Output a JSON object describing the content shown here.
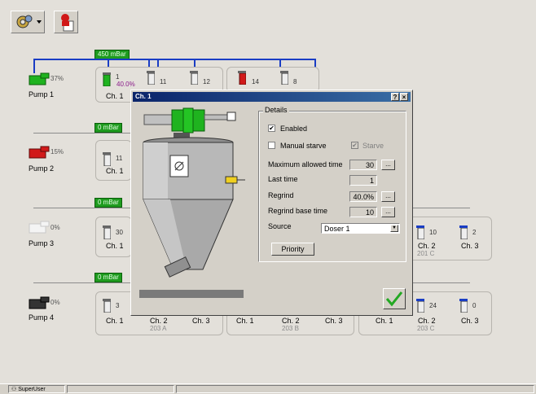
{
  "toolbar": {
    "settings_icon": "gear-cog-icon",
    "alarm_icon": "alarm-person-icon"
  },
  "vacuum": {
    "row1": "450 mBar",
    "row2": "0 mBar",
    "row3": "0 mBar",
    "row4": "0 mBar"
  },
  "pumps": [
    {
      "name": "Pump 1",
      "pct": "37%",
      "color": "#1fb31f"
    },
    {
      "name": "Pump 2",
      "pct": "15%",
      "color": "#d11a1a"
    },
    {
      "name": "Pump 3",
      "pct": "0%",
      "color": "#ececec"
    },
    {
      "name": "Pump 4",
      "pct": "0%",
      "color": "#333333"
    }
  ],
  "row1": {
    "ch1_num": "1",
    "ch1_pct": "40.0%",
    "ch1_label": "Ch. 1",
    "n11": "11",
    "n12": "12",
    "n14": "14",
    "n8": "8"
  },
  "row2": {
    "ch1_num": "11",
    "ch1_label": "Ch. 1"
  },
  "row3": {
    "ch1_num": "30",
    "ch1_label": "Ch. 1",
    "r_n10": "10",
    "r_n2": "2",
    "r_ch2": "Ch. 2",
    "r_ch3": "Ch. 3",
    "r_group": "201 C"
  },
  "row4": {
    "ch1_num": "3",
    "ch1_label": "Ch. 1",
    "ch2": "Ch. 2",
    "ch3": "Ch. 3",
    "group_a": "203 A",
    "b_ch1": "Ch. 1",
    "b_ch2": "Ch. 2",
    "b_ch3": "Ch. 3",
    "group_b": "203 B",
    "c_ch1": "Ch. 1",
    "c_n24": "24",
    "c_n0": "0",
    "c_ch2": "Ch. 2",
    "c_ch3": "Ch. 3",
    "group_c": "203 C"
  },
  "status": {
    "user": "SuperUser"
  },
  "dialog": {
    "title": "Ch. 1",
    "help": "?",
    "close": "×",
    "details_legend": "Details",
    "enabled_label": "Enabled",
    "enabled_checked": true,
    "manual_starve_label": "Manual starve",
    "manual_starve_checked": false,
    "starve_label": "Starve",
    "starve_checked": true,
    "max_time_label": "Maximum allowed time",
    "max_time_value": "30",
    "last_time_label": "Last time",
    "last_time_value": "1",
    "regrind_label": "Regrind",
    "regrind_value": "40.0%",
    "regrind_base_label": "Regrind base time",
    "regrind_base_value": "10",
    "source_label": "Source",
    "source_value": "Doser 1",
    "priority_button": "Priority",
    "ellipsis": "..."
  }
}
